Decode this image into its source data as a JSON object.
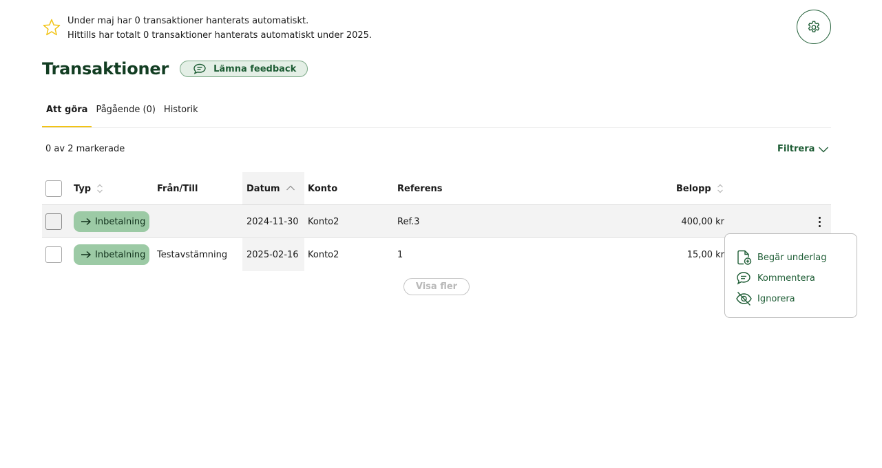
{
  "banner": {
    "icon": "star-icon",
    "line1": "Under maj har 0 transaktioner hanterats automatiskt.",
    "line2": "Hittills har totalt 0 transaktioner hanterats automatiskt under 2025."
  },
  "settings": {
    "icon": "gear-icon"
  },
  "page": {
    "title": "Transaktioner",
    "feedback_label": "Lämna feedback"
  },
  "tabs": [
    {
      "label": "Att göra",
      "active": true
    },
    {
      "label": "Pågående (0)",
      "active": false
    },
    {
      "label": "Historik",
      "active": false
    }
  ],
  "selection": {
    "count_text": "0 av 2 markerade"
  },
  "filter": {
    "label": "Filtrera"
  },
  "table": {
    "headers": {
      "type": "Typ",
      "from_to": "Från/Till",
      "date": "Datum",
      "account": "Konto",
      "reference": "Referens",
      "amount": "Belopp"
    },
    "rows": [
      {
        "type": "Inbetalning",
        "from_to": "",
        "date": "2024-11-30",
        "account": "Konto2",
        "reference": "Ref.3",
        "amount": "400,00 kr"
      },
      {
        "type": "Inbetalning",
        "from_to": "Testavstämning",
        "date": "2025-02-16",
        "account": "Konto2",
        "reference": "1",
        "amount": "15,00 kr"
      }
    ]
  },
  "show_more_label": "Visa fler",
  "context_menu": {
    "items": [
      {
        "label": "Begär underlag",
        "icon": "file-plus-icon"
      },
      {
        "label": "Kommentera",
        "icon": "comment-icon"
      },
      {
        "label": "Ignorera",
        "icon": "eye-off-icon"
      }
    ]
  },
  "colors": {
    "brand_green": "#1d5c34",
    "title_green": "#123d22",
    "pill_green": "#9ccaa5",
    "tab_accent": "#f2c315"
  }
}
